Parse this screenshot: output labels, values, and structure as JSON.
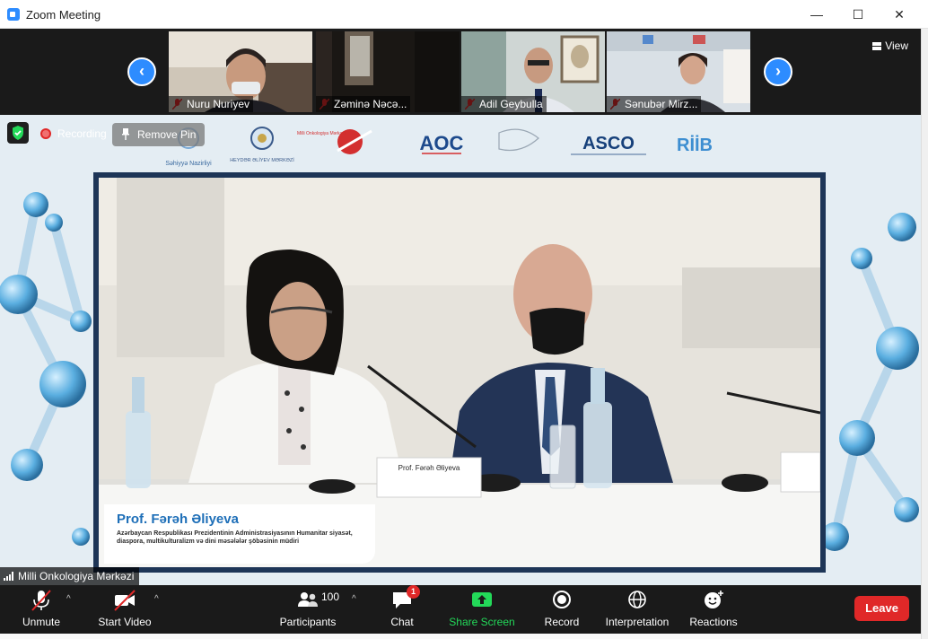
{
  "window": {
    "title": "Zoom Meeting",
    "minimize": "—",
    "maximize": "☐",
    "close": "✕"
  },
  "gallery": {
    "prev_label": "‹",
    "next_label": "›",
    "view_label": "View",
    "participants": [
      {
        "name": "Nuru Nuriyev",
        "muted": true
      },
      {
        "name": "Zəminə Nəcə...",
        "muted": true
      },
      {
        "name": "Adil Geybulla",
        "muted": true
      },
      {
        "name": "Sənubər Mirz...",
        "muted": true
      }
    ]
  },
  "stage": {
    "recording_label": "Recording",
    "remove_pin_label": "Remove Pin",
    "active_speaker": "Milli Onkologiya Mərkəzi",
    "sponsors": [
      "Səhiyyə Nazirliyi",
      "HEYDƏR ƏLİYEV MƏRKƏZİ",
      "Milli Onkologiya Mərkəzi",
      "AOC",
      "ASCO",
      "RİİB"
    ],
    "lower_third": {
      "name": "Prof. Fərəh Əliyeva",
      "description": "Azərbaycan Respublikası Prezidentinin Administrasiyasının Humanitar siyasət, diaspora, multikulturalizm və dini məsələlər şöbəsinin müdiri"
    },
    "desk_nameplate": "Prof. Fərəh Əliyeva"
  },
  "toolbar": {
    "unmute": "Unmute",
    "start_video": "Start Video",
    "participants": "Participants",
    "participant_count": "100",
    "chat": "Chat",
    "chat_badge": "1",
    "share_screen": "Share Screen",
    "record": "Record",
    "interpretation": "Interpretation",
    "reactions": "Reactions",
    "leave": "Leave"
  },
  "colors": {
    "accent": "#2d8cff",
    "share_green": "#23d959",
    "leave_red": "#e02828",
    "toolbar_bg": "#1a1a1a"
  }
}
